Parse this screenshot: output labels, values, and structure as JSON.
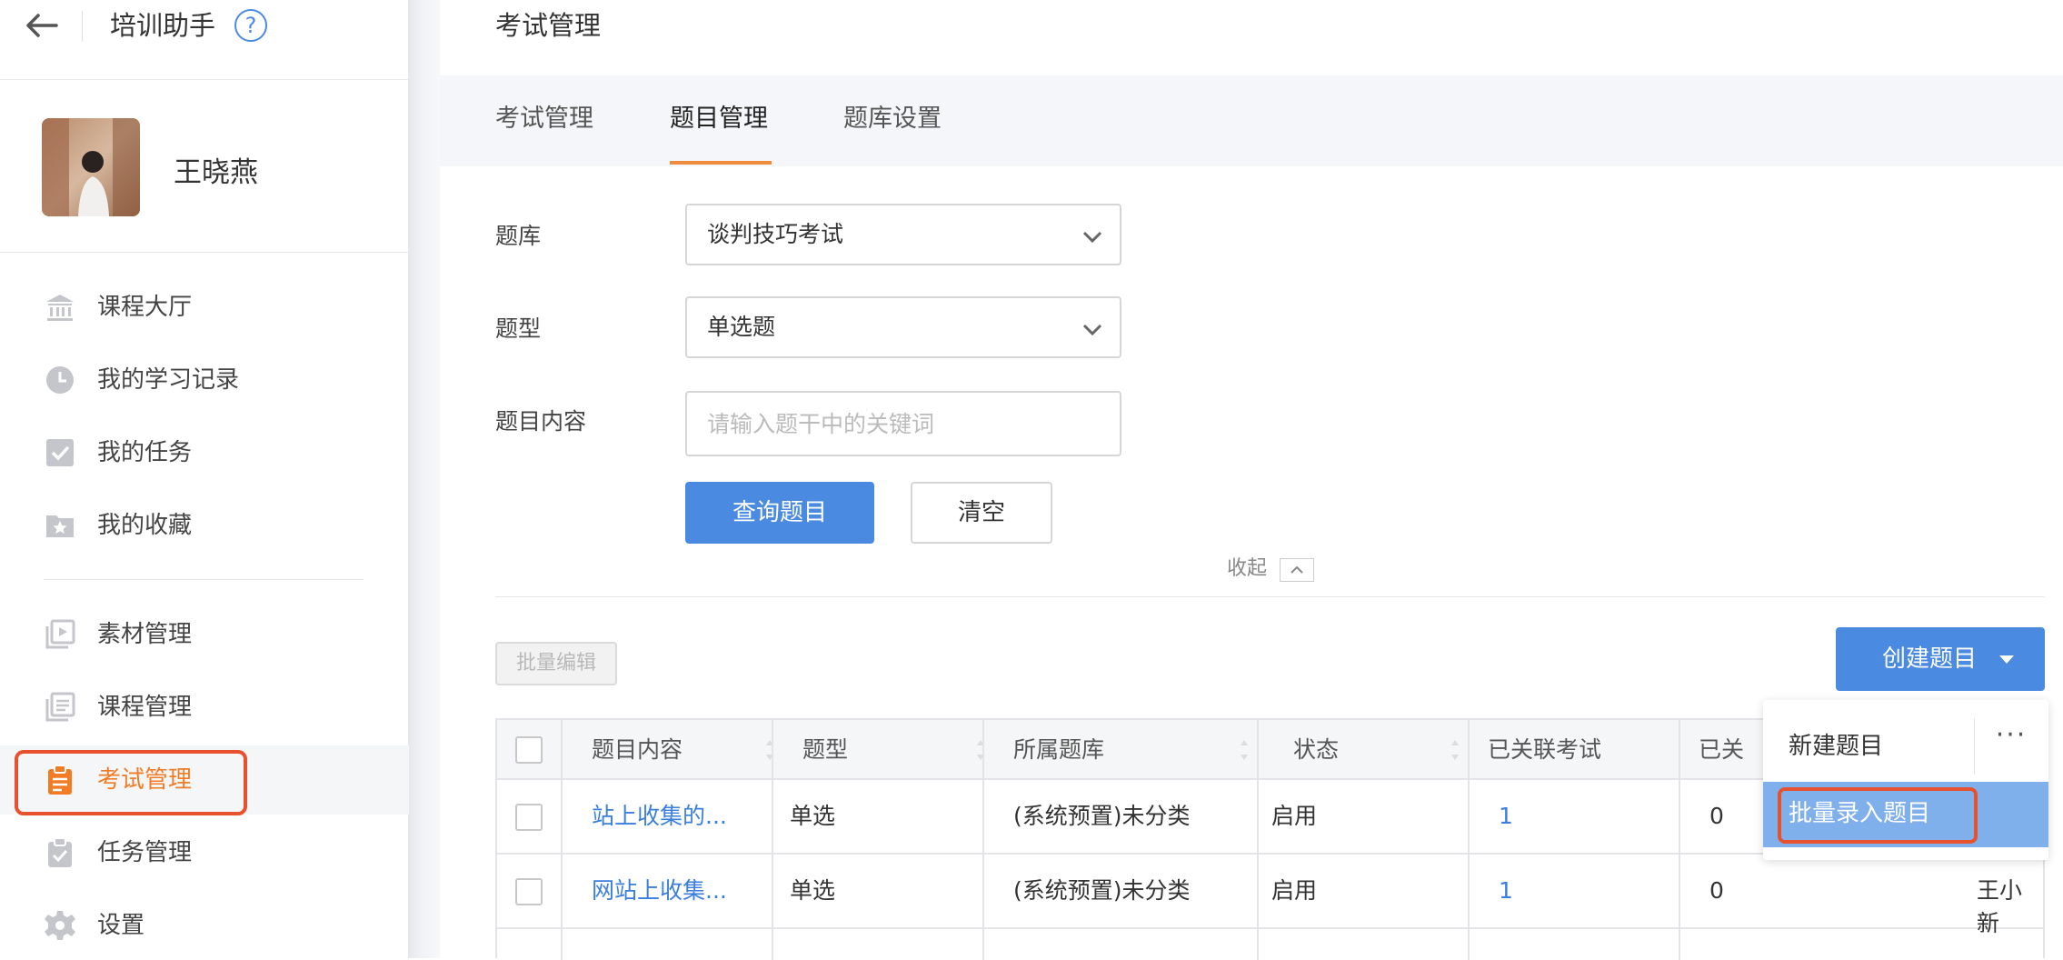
{
  "app": {
    "title": "培训助手",
    "help": "?"
  },
  "user": {
    "name": "王晓燕"
  },
  "nav": {
    "group1": [
      {
        "label": "课程大厅",
        "icon": "bank-icon"
      },
      {
        "label": "我的学习记录",
        "icon": "clock-icon"
      },
      {
        "label": "我的任务",
        "icon": "check-square-icon"
      },
      {
        "label": "我的收藏",
        "icon": "star-folder-icon"
      }
    ],
    "group2": [
      {
        "label": "素材管理",
        "icon": "media-icon"
      },
      {
        "label": "课程管理",
        "icon": "course-icon"
      },
      {
        "label": "考试管理",
        "icon": "clipboard-icon",
        "active": true
      },
      {
        "label": "任务管理",
        "icon": "task-clipboard-icon"
      },
      {
        "label": "设置",
        "icon": "gear-icon"
      }
    ]
  },
  "page": {
    "title": "考试管理"
  },
  "tabs": [
    {
      "label": "考试管理"
    },
    {
      "label": "题目管理",
      "active": true
    },
    {
      "label": "题库设置"
    }
  ],
  "filters": {
    "bank_label": "题库",
    "bank_value": "谈判技巧考试",
    "type_label": "题型",
    "type_value": "单选题",
    "content_label": "题目内容",
    "content_placeholder": "请输入题干中的关键词",
    "search_button": "查询题目",
    "clear_button": "清空",
    "collapse": "收起"
  },
  "toolbar": {
    "batch_edit": "批量编辑",
    "create": "创建题目"
  },
  "table": {
    "headers": [
      "题目内容",
      "题型",
      "所属题库",
      "状态",
      "已关联考试",
      "已关"
    ],
    "rows": [
      {
        "content": "站上收集的...",
        "type": "单选",
        "bank": "(系统预置)未分类",
        "status": "启用",
        "exams": "1",
        "other": "0",
        "creator": ""
      },
      {
        "content": "网站上收集...",
        "type": "单选",
        "bank": "(系统预置)未分类",
        "status": "启用",
        "exams": "1",
        "other": "0",
        "creator": "王小新"
      }
    ]
  },
  "dropdown": {
    "items": [
      "新建题目",
      "批量录入题目"
    ],
    "more": "···"
  },
  "colors": {
    "accent": "#4a8ae0",
    "active_nav": "#f27c25",
    "highlight": "#e8512e",
    "tab_underline": "#f08a3c"
  }
}
